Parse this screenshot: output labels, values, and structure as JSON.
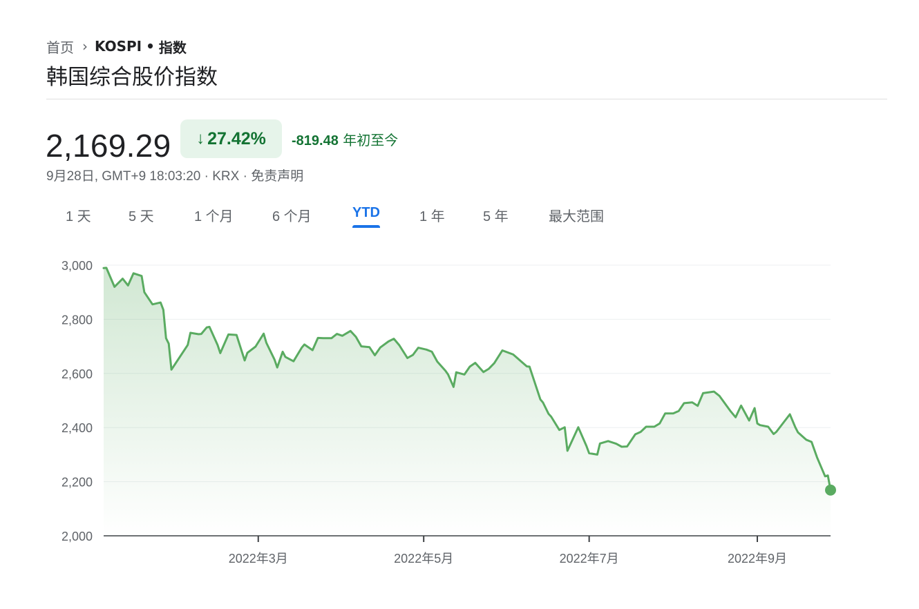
{
  "breadcrumb": {
    "home": "首页",
    "separator": "›",
    "symbol": "KOSPI",
    "dot": "•",
    "type": "指数"
  },
  "title": "韩国综合股价指数",
  "quote": {
    "price": "2,169.29",
    "change_pct": "27.42%",
    "change_abs": "-819.48",
    "period_label": "年初至今",
    "timestamp": "9月28日, GMT+9 18:03:20 · KRX · ",
    "disclaimer": "免责声明"
  },
  "tabs": [
    {
      "label": "1 天"
    },
    {
      "label": "5 天"
    },
    {
      "label": "1 个月"
    },
    {
      "label": "6 个月"
    },
    {
      "label": "YTD",
      "active": true
    },
    {
      "label": "1 年"
    },
    {
      "label": "5 年"
    },
    {
      "label": "最大范围"
    }
  ],
  "colors": {
    "line": "#5aab61",
    "fill": "#e6f4ea",
    "positive_text": "#137333",
    "accent": "#1a73e8"
  },
  "icons": {
    "change_arrow": "arrow-down-icon"
  },
  "chart_data": {
    "type": "area",
    "xlabel": "",
    "ylabel": "",
    "ylim": [
      2000,
      3000
    ],
    "yticks": [
      3000,
      2800,
      2600,
      2400,
      2200,
      2000
    ],
    "ytick_labels": [
      "3,000",
      "2,800",
      "2,600",
      "2,400",
      "2,200",
      "2,000"
    ],
    "xlim": [
      "2022-01-03",
      "2022-09-28"
    ],
    "xticks": [
      {
        "date": "2022-03-01",
        "label": "2022年3月"
      },
      {
        "date": "2022-05-01",
        "label": "2022年5月"
      },
      {
        "date": "2022-07-01",
        "label": "2022年7月"
      },
      {
        "date": "2022-09-01",
        "label": "2022年9月"
      }
    ],
    "grid": true,
    "series": [
      {
        "x": [
          "2022-01-03",
          "2022-01-04",
          "2022-01-07",
          "2022-01-10",
          "2022-01-12",
          "2022-01-14",
          "2022-01-17",
          "2022-01-18",
          "2022-01-21",
          "2022-01-24",
          "2022-01-25",
          "2022-01-26",
          "2022-01-27",
          "2022-01-28",
          "2022-02-03",
          "2022-02-04",
          "2022-02-07",
          "2022-02-08",
          "2022-02-10",
          "2022-02-11",
          "2022-02-14",
          "2022-02-15",
          "2022-02-18",
          "2022-02-21",
          "2022-02-24",
          "2022-02-25",
          "2022-02-28",
          "2022-03-03",
          "2022-03-04",
          "2022-03-07",
          "2022-03-08",
          "2022-03-10",
          "2022-03-11",
          "2022-03-14",
          "2022-03-17",
          "2022-03-18",
          "2022-03-21",
          "2022-03-23",
          "2022-03-25",
          "2022-03-28",
          "2022-03-30",
          "2022-04-01",
          "2022-04-04",
          "2022-04-06",
          "2022-04-08",
          "2022-04-11",
          "2022-04-13",
          "2022-04-15",
          "2022-04-18",
          "2022-04-20",
          "2022-04-22",
          "2022-04-25",
          "2022-04-27",
          "2022-04-29",
          "2022-05-02",
          "2022-05-04",
          "2022-05-06",
          "2022-05-09",
          "2022-05-10",
          "2022-05-12",
          "2022-05-13",
          "2022-05-16",
          "2022-05-18",
          "2022-05-20",
          "2022-05-23",
          "2022-05-25",
          "2022-05-27",
          "2022-05-30",
          "2022-06-03",
          "2022-06-08",
          "2022-06-09",
          "2022-06-10",
          "2022-06-13",
          "2022-06-14",
          "2022-06-16",
          "2022-06-17",
          "2022-06-20",
          "2022-06-22",
          "2022-06-23",
          "2022-06-27",
          "2022-06-30",
          "2022-07-01",
          "2022-07-04",
          "2022-07-05",
          "2022-07-08",
          "2022-07-11",
          "2022-07-13",
          "2022-07-15",
          "2022-07-18",
          "2022-07-20",
          "2022-07-22",
          "2022-07-25",
          "2022-07-27",
          "2022-07-29",
          "2022-08-01",
          "2022-08-03",
          "2022-08-05",
          "2022-08-08",
          "2022-08-10",
          "2022-08-12",
          "2022-08-16",
          "2022-08-18",
          "2022-08-22",
          "2022-08-24",
          "2022-08-26",
          "2022-08-29",
          "2022-08-31",
          "2022-09-01",
          "2022-09-02",
          "2022-09-05",
          "2022-09-07",
          "2022-09-08",
          "2022-09-13",
          "2022-09-15",
          "2022-09-16",
          "2022-09-19",
          "2022-09-21",
          "2022-09-23",
          "2022-09-26",
          "2022-09-27",
          "2022-09-28"
        ],
        "values": [
          2989,
          2990,
          2920,
          2950,
          2925,
          2970,
          2960,
          2900,
          2855,
          2862,
          2835,
          2730,
          2710,
          2614,
          2705,
          2750,
          2745,
          2746,
          2770,
          2772,
          2705,
          2675,
          2744,
          2742,
          2648,
          2676,
          2699,
          2747,
          2713,
          2651,
          2622,
          2680,
          2661,
          2645,
          2695,
          2707,
          2686,
          2731,
          2730,
          2730,
          2746,
          2739,
          2757,
          2735,
          2700,
          2697,
          2667,
          2696,
          2718,
          2728,
          2704,
          2657,
          2668,
          2695,
          2688,
          2680,
          2644,
          2610,
          2596,
          2550,
          2604,
          2596,
          2625,
          2639,
          2605,
          2617,
          2638,
          2685,
          2670,
          2626,
          2625,
          2595,
          2504,
          2492,
          2451,
          2440,
          2391,
          2401,
          2314,
          2401,
          2332,
          2305,
          2300,
          2341,
          2350,
          2340,
          2329,
          2330,
          2375,
          2384,
          2403,
          2403,
          2415,
          2452,
          2452,
          2461,
          2490,
          2493,
          2480,
          2527,
          2533,
          2517,
          2462,
          2438,
          2481,
          2426,
          2472,
          2415,
          2409,
          2403,
          2376,
          2384,
          2449,
          2401,
          2382,
          2355,
          2347,
          2290,
          2220,
          2223,
          2169
        ]
      }
    ]
  }
}
